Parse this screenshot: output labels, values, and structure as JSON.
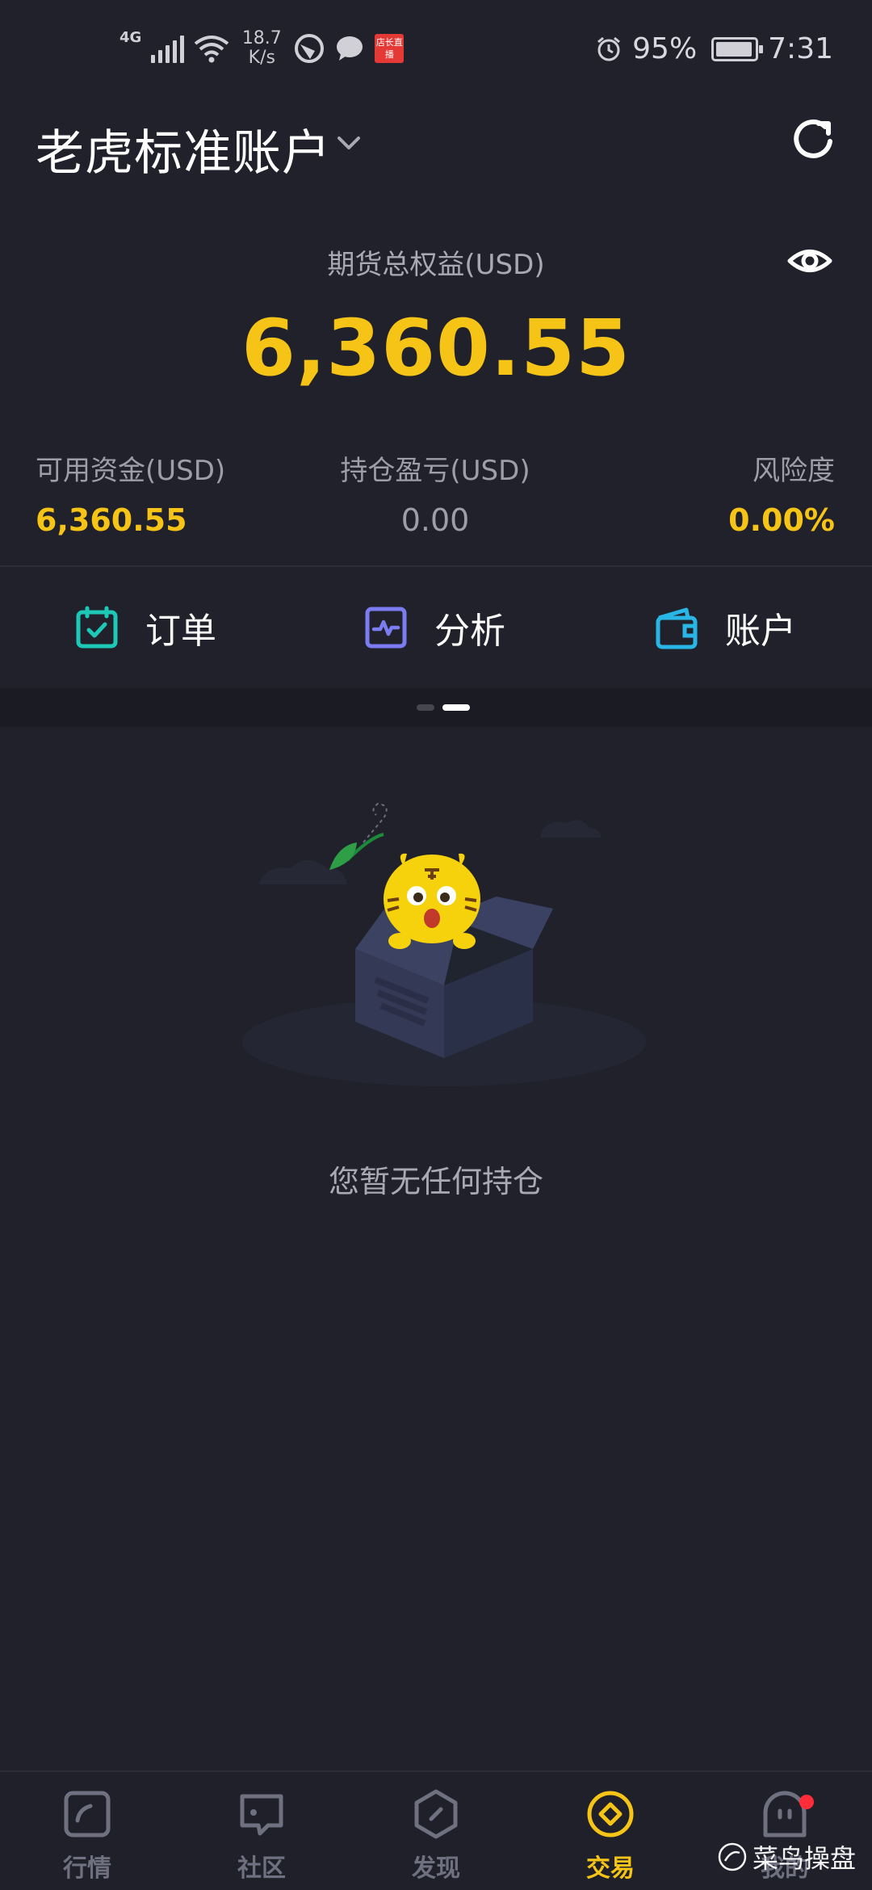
{
  "status_bar": {
    "network_type": "4G",
    "speed_value": "18.7",
    "speed_unit": "K/s",
    "live_badge": "店长直播",
    "battery_percent": "95%",
    "time": "7:31",
    "battery_level": 0.95
  },
  "header": {
    "account_title": "老虎标准账户"
  },
  "equity": {
    "label": "期货总权益(USD)",
    "value": "6,360.55"
  },
  "stats": [
    {
      "label": "可用资金(USD)",
      "value": "6,360.55"
    },
    {
      "label": "持仓盈亏(USD)",
      "value": "0.00"
    },
    {
      "label": "风险度",
      "value": "0.00%"
    }
  ],
  "actions": [
    {
      "label": "订单",
      "icon": "calendar-check-icon"
    },
    {
      "label": "分析",
      "icon": "pulse-chart-icon"
    },
    {
      "label": "账户",
      "icon": "wallet-icon"
    }
  ],
  "pager": {
    "page_count": 2,
    "active_page": 2
  },
  "empty_state": {
    "message": "您暂无任何持仓"
  },
  "bottom_nav": [
    {
      "label": "行情",
      "icon": "market-icon",
      "active": false
    },
    {
      "label": "社区",
      "icon": "community-icon",
      "active": false
    },
    {
      "label": "发现",
      "icon": "discover-icon",
      "active": false
    },
    {
      "label": "交易",
      "icon": "trade-icon",
      "active": true
    },
    {
      "label": "我的",
      "icon": "profile-icon",
      "active": false,
      "badge": true
    }
  ],
  "watermark": "菜鸟操盘",
  "colors": {
    "background": "#20212b",
    "accent_yellow": "#f5c416",
    "order_teal": "#1ec8b7",
    "analysis_purple": "#7b7cf0",
    "account_cyan": "#29b6e6",
    "badge_red": "#ff2d3a"
  }
}
